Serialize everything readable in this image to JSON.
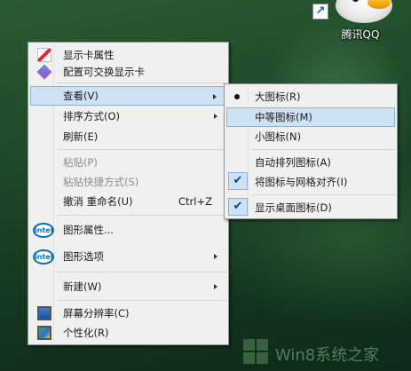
{
  "desktop": {
    "qq_label": "腾讯QQ",
    "shortcut_glyph": "↗"
  },
  "watermark": {
    "text": "Win8系统之家"
  },
  "context_menu": {
    "items": [
      {
        "label": "显示卡属性"
      },
      {
        "label": "配置可交换显示卡"
      },
      {
        "label": "查看(V)"
      },
      {
        "label": "排序方式(O)"
      },
      {
        "label": "刷新(E)"
      },
      {
        "label": "粘贴(P)"
      },
      {
        "label": "粘贴快捷方式(S)"
      },
      {
        "label": "撤消 重命名(U)",
        "accel": "Ctrl+Z"
      },
      {
        "label": "图形属性..."
      },
      {
        "label": "图形选项"
      },
      {
        "label": "新建(W)"
      },
      {
        "label": "屏幕分辨率(C)"
      },
      {
        "label": "个性化(R)"
      }
    ],
    "intel_text": "intel"
  },
  "view_submenu": {
    "items": [
      {
        "label": "大图标(R)",
        "mark": "bullet"
      },
      {
        "label": "中等图标(M)"
      },
      {
        "label": "小图标(N)"
      },
      {
        "label": "自动排列图标(A)"
      },
      {
        "label": "将图标与网格对齐(I)",
        "mark": "check"
      },
      {
        "label": "显示桌面图标(D)",
        "mark": "check"
      }
    ],
    "check_glyph": "✔"
  },
  "colors": {
    "menu_bg": "#f0f0f0",
    "highlight": "#cfe2f3",
    "highlight_border": "#8cb2d9",
    "disabled_text": "#8d8d8d"
  }
}
